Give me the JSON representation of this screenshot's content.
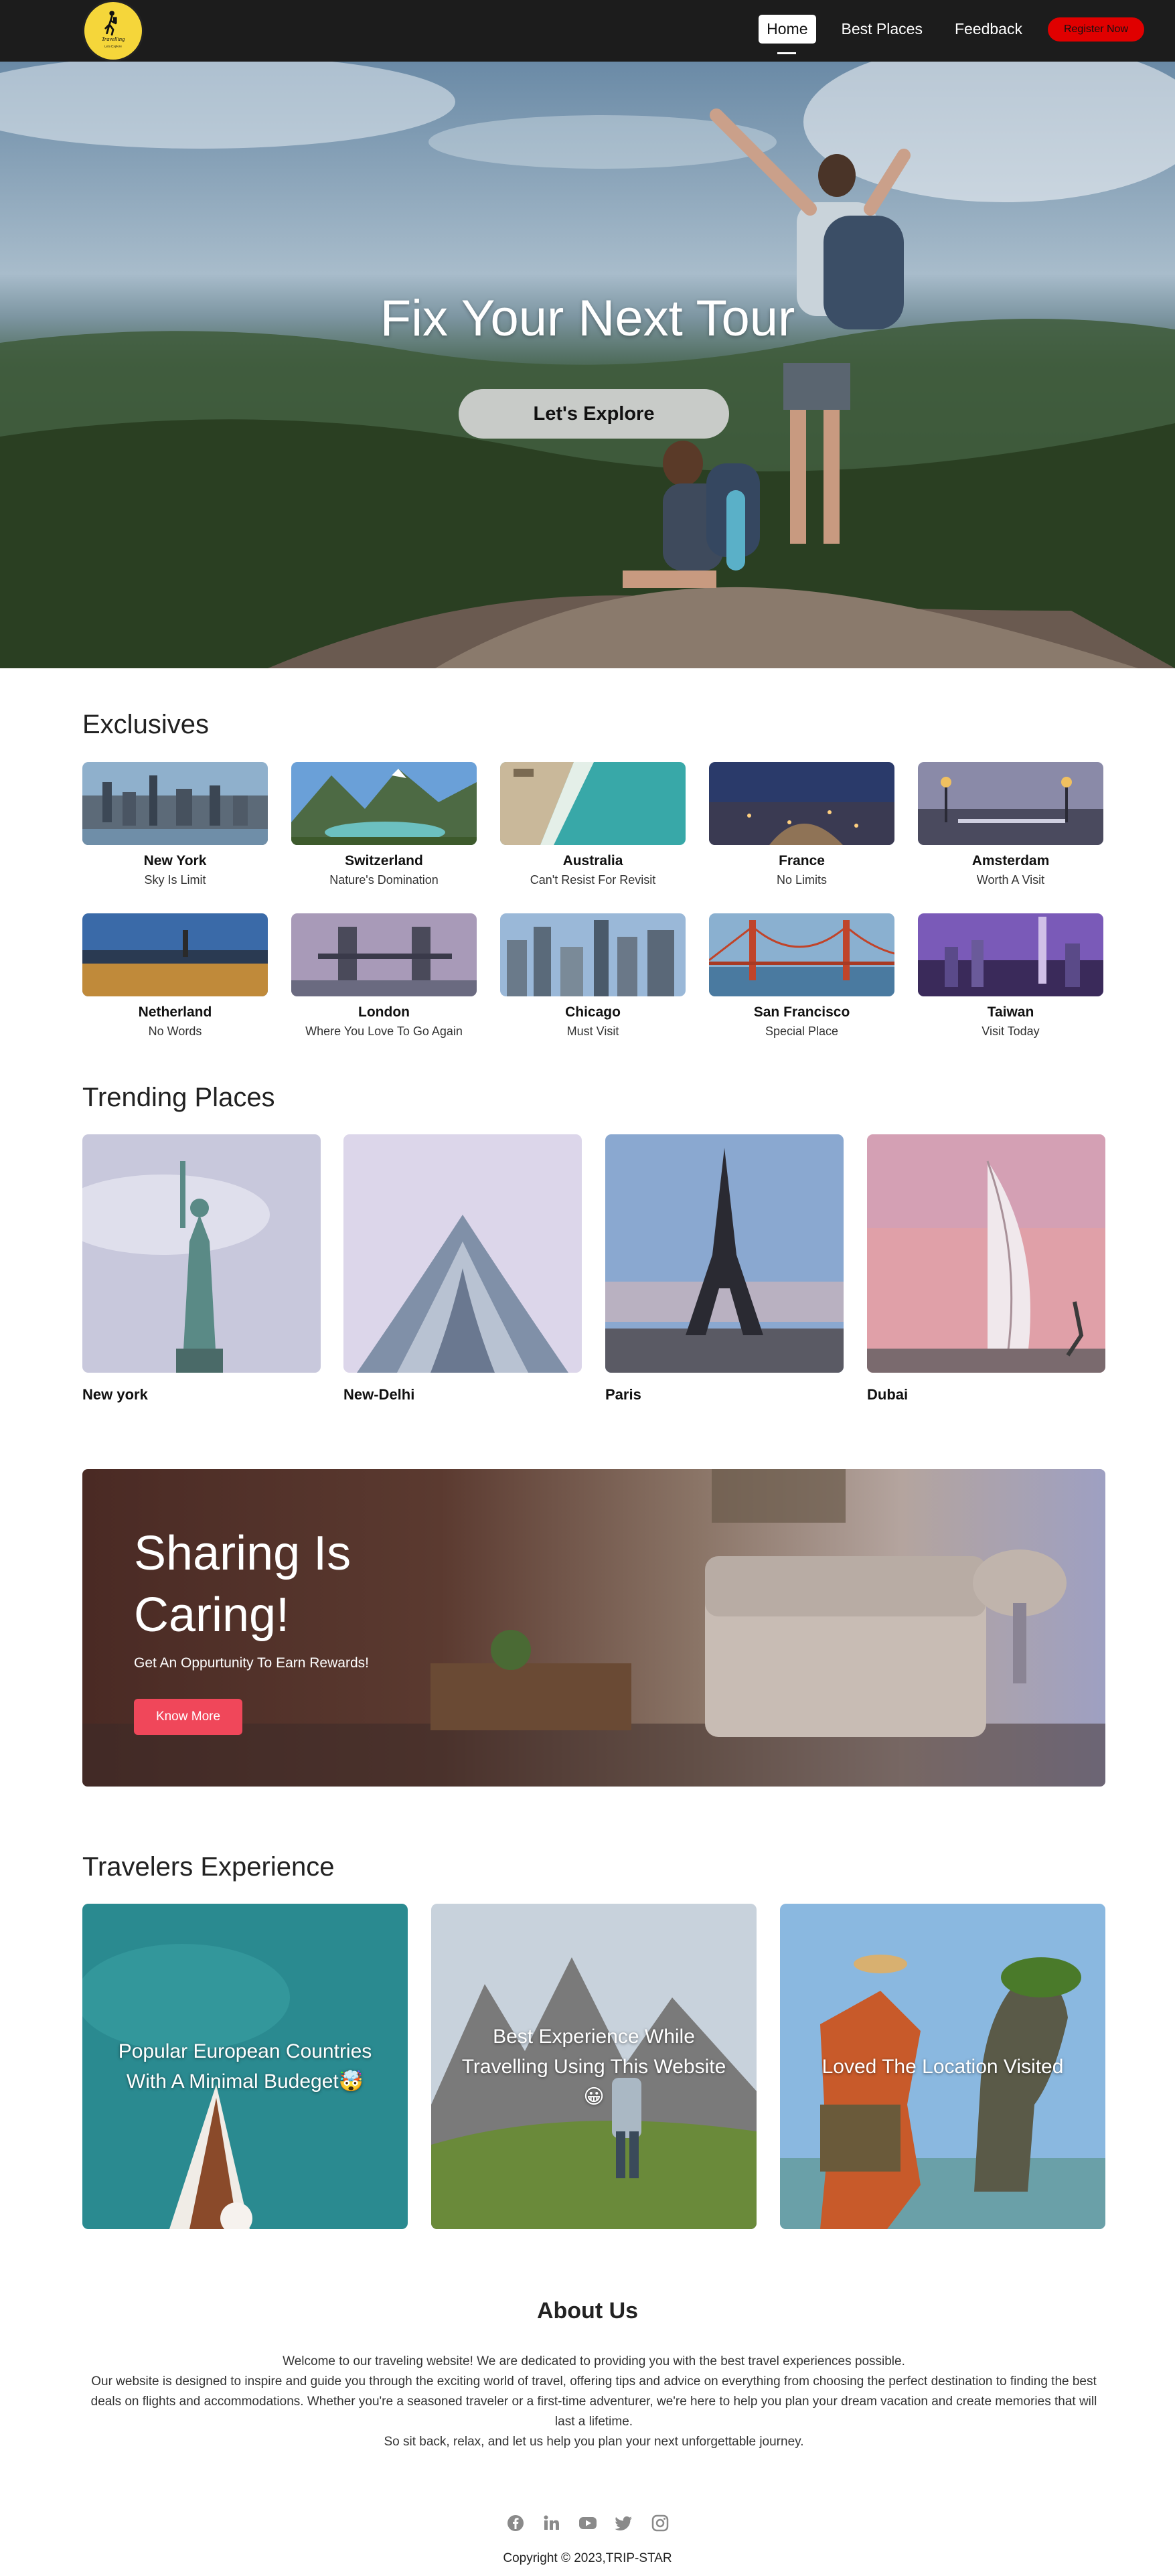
{
  "nav": {
    "logo_title": "Travelling",
    "logo_subtitle": "Lets Explore",
    "links": [
      "Home",
      "Best Places",
      "Feedback"
    ],
    "register_label": "Register Now"
  },
  "hero": {
    "title": "Fix Your Next Tour",
    "button_label": "Let's Explore"
  },
  "exclusives": {
    "title": "Exclusives",
    "items": [
      {
        "name": "New York",
        "tag": "Sky Is Limit"
      },
      {
        "name": "Switzerland",
        "tag": "Nature's Domination"
      },
      {
        "name": "Australia",
        "tag": "Can't Resist For Revisit"
      },
      {
        "name": "France",
        "tag": "No Limits"
      },
      {
        "name": "Amsterdam",
        "tag": "Worth A Visit"
      },
      {
        "name": "Netherland",
        "tag": "No Words"
      },
      {
        "name": "London",
        "tag": "Where You Love To Go Again"
      },
      {
        "name": "Chicago",
        "tag": "Must Visit"
      },
      {
        "name": "San Francisco",
        "tag": "Special Place"
      },
      {
        "name": "Taiwan",
        "tag": "Visit Today"
      }
    ]
  },
  "trending": {
    "title": "Trending Places",
    "items": [
      "New york",
      "New-Delhi",
      "Paris",
      "Dubai"
    ]
  },
  "sharing": {
    "title": "Sharing Is Caring!",
    "subtitle": "Get An Oppurtunity To Earn Rewards!",
    "button_label": "Know More"
  },
  "experience": {
    "title": "Travelers Experience",
    "items": [
      "Popular European Countries With A Minimal Budeget🤯",
      "Best Experience While Travelling Using This Website😀",
      "Loved The Location Visited"
    ]
  },
  "about": {
    "title": "About Us",
    "lines": [
      "Welcome to our traveling website! We are dedicated to providing you with the best travel experiences possible.",
      "Our website is designed to inspire and guide you through the exciting world of travel, offering tips and advice on everything from choosing the perfect destination to finding the best deals on flights and accommodations. Whether you're a seasoned traveler or a first-time adventurer, we're here to help you plan your dream vacation and create memories that will last a lifetime.",
      "So sit back, relax, and let us help you plan your next unforgettable journey."
    ]
  },
  "footer": {
    "social_icons": [
      "facebook-icon",
      "linkedin-icon",
      "youtube-icon",
      "twitter-icon",
      "instagram-icon"
    ],
    "copyright": "Copyright © 2023,TRIP-STAR"
  },
  "colors": {
    "nav_bg": "#1c1c1c",
    "register_button": "#e00000",
    "accent_button": "#f0475a",
    "logo": "#f5d63a"
  }
}
